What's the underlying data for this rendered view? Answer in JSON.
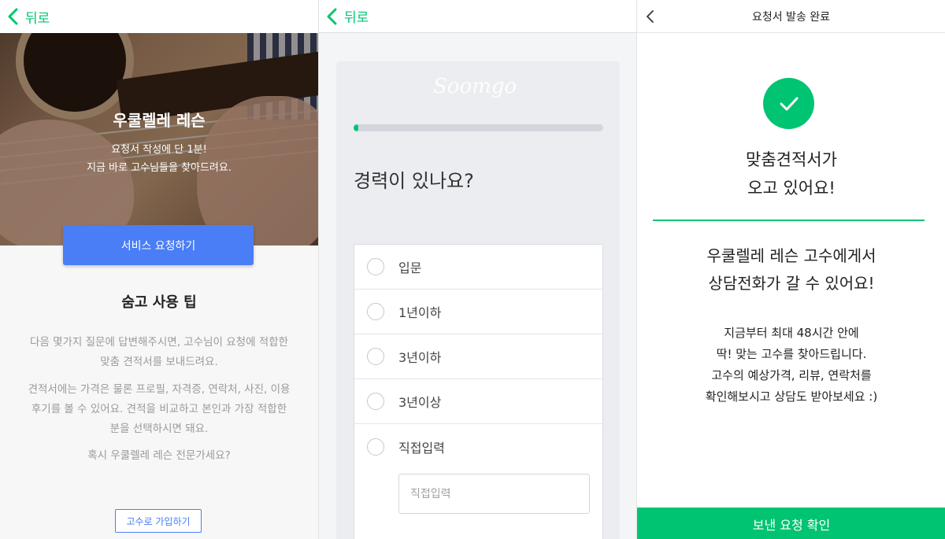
{
  "screen1": {
    "back_label": "뒤로",
    "hero_title": "우쿨렐레 레슨",
    "hero_subtitle_line1": "요청서 작성에 단 1분!",
    "hero_subtitle_line2": "지금 바로 고수님들을 찾아드려요.",
    "cta_label": "서비스 요청하기",
    "tips_title": "숨고 사용 팁",
    "tip1_line1": "다음 몇가지 질문에 답변해주시면, 고수님이 요청에 적합한",
    "tip1_line2": "맞춤 견적서를 보내드려요.",
    "tip2_line1": "견적서에는 가격은 물론 프로필, 자격증, 연락처, 사진, 이용",
    "tip2_line2": "후기를 볼 수 있어요. 견적을 비교하고 본인과 가장 적합한",
    "tip2_line3": "분을 선택하시면 돼요.",
    "expert_question": "혹시 우쿨렐레 레슨 전문가세요?",
    "signup_label": "고수로 가입하기"
  },
  "screen2": {
    "back_label": "뒤로",
    "watermark": "Soomgo",
    "progress": 0.02,
    "question": "경력이 있나요?",
    "options": [
      "입문",
      "1년이하",
      "3년이하",
      "3년이상",
      "직접입력"
    ],
    "custom_placeholder": "직접입력"
  },
  "screen3": {
    "title": "요청서 발송 완료",
    "headline_line1": "맞춤견적서가",
    "headline_line2": "오고 있어요!",
    "sub_line1": "우쿨렐레 레슨 고수에게서",
    "sub_line2": "상담전화가 갈 수 있어요!",
    "body_line1": "지금부터 최대 48시간 안에",
    "body_line2": "딱! 맞는 고수를 찾아드립니다.",
    "body_line3": "고수의 예상가격, 리뷰, 연락처를",
    "body_line4": "확인해보시고 상담도 받아보세요 :)",
    "confirm_label": "보낸 요청 확인"
  },
  "colors": {
    "accent_green": "#00c471",
    "accent_blue": "#4a7ef6"
  },
  "icons": [
    "chevron-left-icon",
    "checkmark-icon",
    "radio-icon"
  ]
}
